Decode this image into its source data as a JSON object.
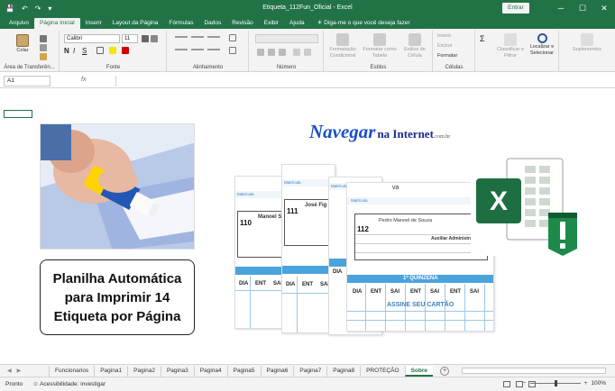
{
  "window": {
    "title": "Etiqueta_112Fun_Oficial  -  Excel",
    "signin_label": "Entrar",
    "controls": [
      "─",
      "☐",
      "✕"
    ],
    "qat_icons": [
      "save-icon",
      "undo-icon",
      "redo-icon",
      "customize-icon"
    ]
  },
  "menu": {
    "tabs": [
      "Arquivo",
      "Página Inicial",
      "Inserir",
      "Layout da Página",
      "Fórmulas",
      "Dados",
      "Revisão",
      "Exibir",
      "Ajuda"
    ],
    "active_index": 1,
    "tell_me": "Diga-me o que você deseja fazer"
  },
  "ribbon": {
    "clipboard": {
      "label": "Área de Transferên...",
      "paste": "Colar"
    },
    "font": {
      "label": "Fonte",
      "name": "Calibri",
      "size": "11"
    },
    "alignment": {
      "label": "Alinhamento"
    },
    "number": {
      "label": "Número"
    },
    "styles": {
      "label": "Estilos",
      "cond_format": "Formatação Condicional",
      "format_table": "Formatar como Tabela",
      "cell_styles": "Estilos de Célula"
    },
    "cells": {
      "label": "Células",
      "insert": "Inserir",
      "delete": "Excluir",
      "format": "Formatar"
    },
    "editing": {
      "sort": "Classificar e Filtrar",
      "find": "Localizar e Selecionar"
    },
    "addins": {
      "label": "Suplementos"
    }
  },
  "formula_bar": {
    "cell_ref": "A1",
    "fx": "fx",
    "content": ""
  },
  "sheet": {
    "caption": "Planilha Automática para Imprimir 14 Etiqueta por Página",
    "logo_main": "Navegar",
    "logo_sub": "na Internet",
    "logo_tld": ".com.br",
    "cards": {
      "header_label": "Matrícula",
      "front_name": "Pedro Manoel de Souza",
      "front_number": "112",
      "front_role": "Auxiliar Administrativo",
      "name_2": "José Fig",
      "name_1": "Manoel S",
      "number_2": "111",
      "number_1": "110",
      "quinzena": "1ª QUINZENA",
      "assine": "ASSINE SEU CARTÃO",
      "cols": [
        "DIA",
        "ENT",
        "SAI",
        "ENT",
        "SAI",
        "ENT",
        "SAI"
      ],
      "va": "va"
    }
  },
  "sheet_tabs": [
    "Funcionarios",
    "Pagina1",
    "Pagina2",
    "Pagina3",
    "Pagina4",
    "Pagina5",
    "Pagina6",
    "Pagina7",
    "Pagina8",
    "PROTEÇÃO",
    "Sobre"
  ],
  "active_sheet": 10,
  "status": {
    "ready": "Pronto",
    "accessibility": "Acessibilidade: investigar",
    "zoom": "100%"
  }
}
